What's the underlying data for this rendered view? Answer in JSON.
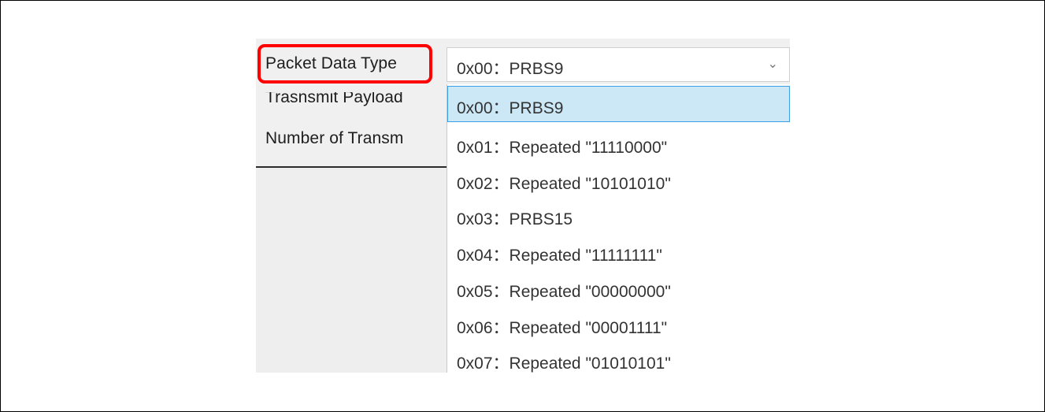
{
  "form": {
    "labels": {
      "packet_data_type": "Packet Data Type",
      "transmit_payload": "Trasnsmit Payload",
      "number_of_transmissions": "Number of Transm"
    },
    "packet_data_type": {
      "selected": "0x00：PRBS9",
      "options": [
        "0x00：PRBS9",
        "0x01：Repeated \"11110000\"",
        "0x02：Repeated \"10101010\"",
        "0x03：PRBS15",
        "0x04：Repeated \"11111111\"",
        "0x05：Repeated \"00000000\"",
        "0x06：Repeated \"00001111\"",
        "0x07：Repeated \"01010101\""
      ],
      "highlighted_index": 0
    }
  },
  "icons": {
    "combo_arrow": "chevron-down-icon"
  },
  "colors": {
    "highlight_box": "#ff0000",
    "selected_option_bg": "#cce8f7",
    "selected_option_border": "#3d9fe0"
  }
}
